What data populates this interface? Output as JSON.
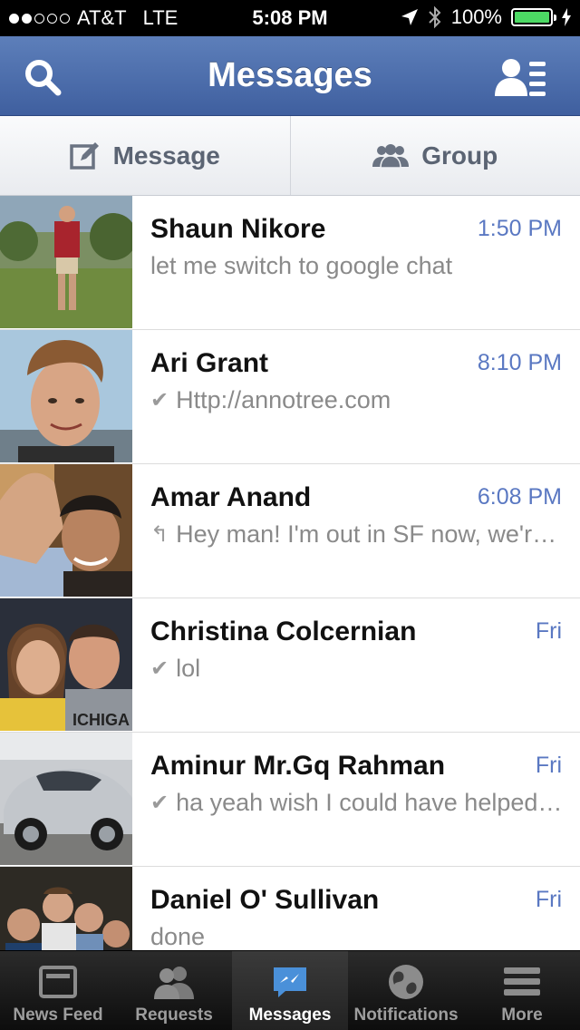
{
  "status_bar": {
    "carrier": "AT&T",
    "network": "LTE",
    "time": "5:08 PM",
    "battery": "100%",
    "signal_bars_filled": 2,
    "signal_bars_total": 5
  },
  "nav": {
    "title": "Messages",
    "left_icon": "search-icon",
    "right_icon": "friends-list-icon",
    "bar_color": "#4a6aab"
  },
  "actions": {
    "message_label": "Message",
    "group_label": "Group"
  },
  "threads": [
    {
      "name": "Shaun Nikore",
      "time": "1:50 PM",
      "snippet": "let me switch to google chat",
      "status_icon": ""
    },
    {
      "name": "Ari Grant",
      "time": "8:10 PM",
      "snippet": "Http://annotree.com",
      "status_icon": "check-icon"
    },
    {
      "name": "Amar Anand",
      "time": "6:08 PM",
      "snippet": "Hey man! I'm out in SF now, we're at the office if you want to grab lunch",
      "status_icon": "reply-icon"
    },
    {
      "name": "Christina Colcernian",
      "time": "Fri",
      "snippet": "lol",
      "status_icon": "check-icon"
    },
    {
      "name": "Aminur Mr.Gq Rahman",
      "time": "Fri",
      "snippet": "ha yeah wish I could have helped more",
      "status_icon": "check-icon"
    },
    {
      "name": "Daniel O' Sullivan",
      "time": "Fri",
      "snippet": "done",
      "status_icon": ""
    }
  ],
  "tabs": [
    {
      "label": "News Feed",
      "icon": "news-feed-icon",
      "active": false
    },
    {
      "label": "Requests",
      "icon": "requests-icon",
      "active": false
    },
    {
      "label": "Messages",
      "icon": "messages-icon",
      "active": true
    },
    {
      "label": "Notifications",
      "icon": "globe-icon",
      "active": false
    },
    {
      "label": "More",
      "icon": "menu-icon",
      "active": false
    }
  ],
  "colors": {
    "accent_time": "#5a78c2",
    "active_tab_icon": "#4a90d9",
    "battery_fill": "#4cd964"
  }
}
